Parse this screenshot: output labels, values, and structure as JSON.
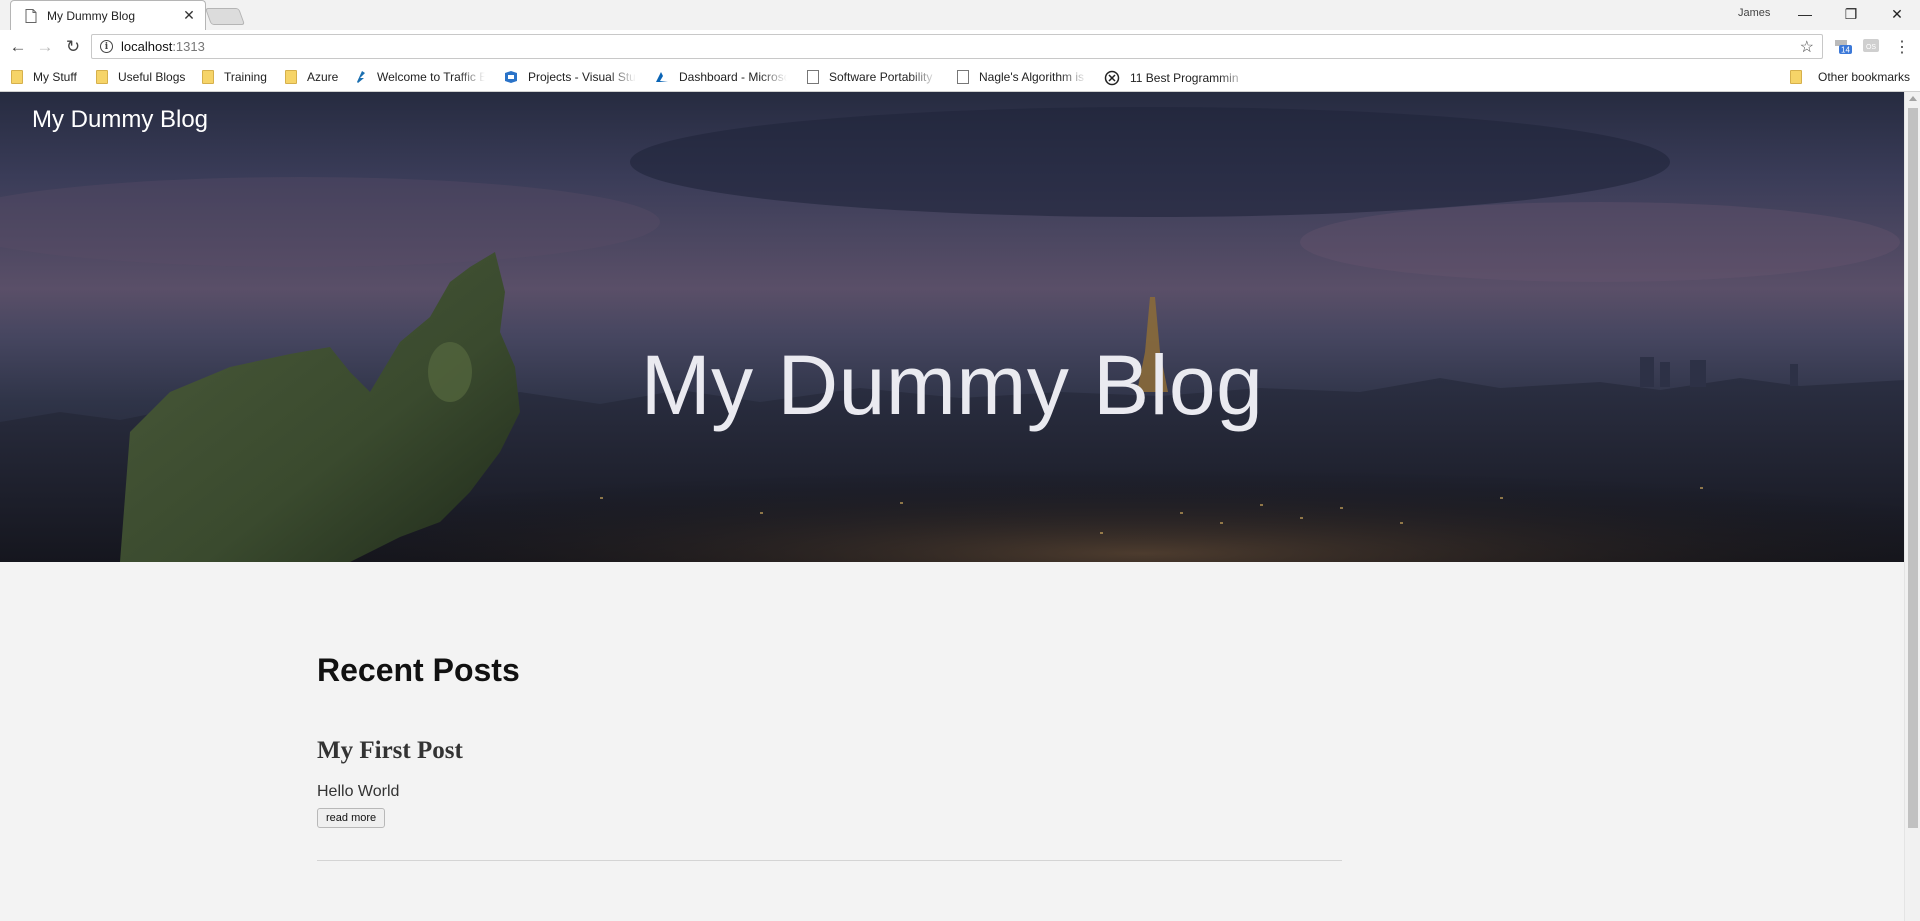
{
  "browser": {
    "tab_title": "My Dummy Blog",
    "profile_name": "James",
    "url_host": "localhost",
    "url_port": ":1313",
    "extension_badge": "14",
    "extension_label": "OS",
    "bookmarks": [
      {
        "label": "My Stuff",
        "icon": "folder-icon"
      },
      {
        "label": "Useful Blogs",
        "icon": "folder-icon"
      },
      {
        "label": "Training",
        "icon": "folder-icon"
      },
      {
        "label": "Azure",
        "icon": "folder-icon"
      },
      {
        "label": "Welcome to Traffic E",
        "icon": "traffic-icon"
      },
      {
        "label": "Projects - Visual Stu",
        "icon": "visual-studio-icon"
      },
      {
        "label": "Dashboard - Microso",
        "icon": "azure-icon"
      },
      {
        "label": "Software Portability",
        "icon": "page-icon"
      },
      {
        "label": "Nagle's Algorithm is",
        "icon": "page-icon"
      },
      {
        "label": "11 Best Programmin",
        "icon": "circle-x-icon"
      }
    ],
    "other_bookmarks": "Other bookmarks"
  },
  "site": {
    "brand": "My Dummy Blog",
    "hero_title": "My Dummy Blog"
  },
  "main": {
    "section_title": "Recent Posts",
    "posts": [
      {
        "title": "My First Post",
        "summary": "Hello World",
        "read_more": "read more"
      }
    ]
  }
}
